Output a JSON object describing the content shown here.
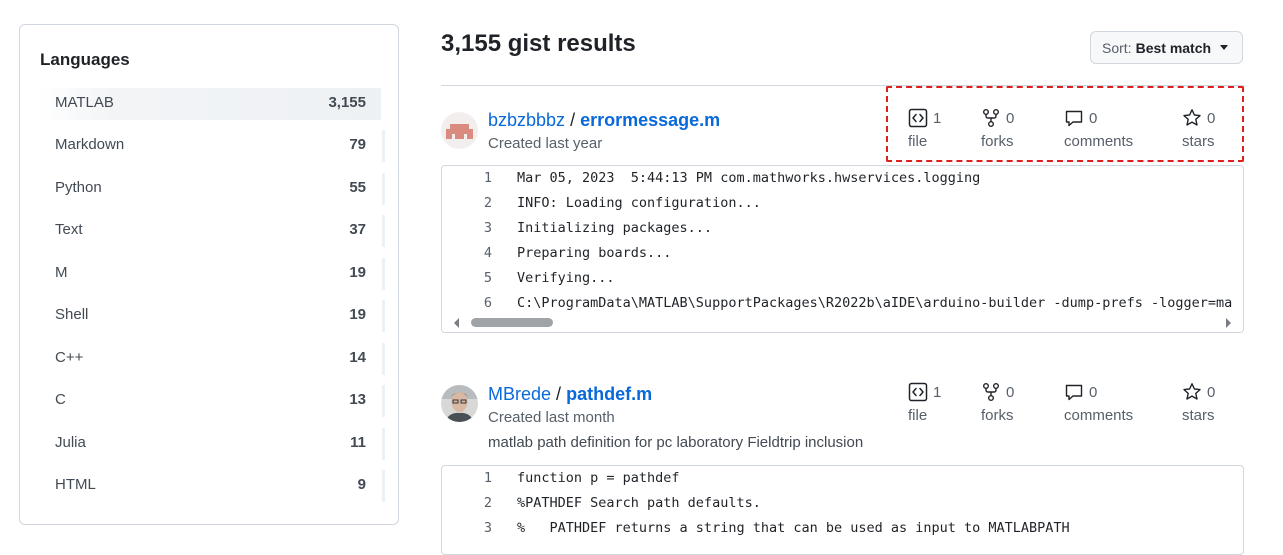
{
  "sidebar": {
    "title": "Languages",
    "items": [
      {
        "name": "MATLAB",
        "count": "3,155",
        "selected": true
      },
      {
        "name": "Markdown",
        "count": "79"
      },
      {
        "name": "Python",
        "count": "55"
      },
      {
        "name": "Text",
        "count": "37"
      },
      {
        "name": "M",
        "count": "19"
      },
      {
        "name": "Shell",
        "count": "19"
      },
      {
        "name": "C++",
        "count": "14"
      },
      {
        "name": "C",
        "count": "13"
      },
      {
        "name": "Julia",
        "count": "11"
      },
      {
        "name": "HTML",
        "count": "9"
      }
    ]
  },
  "main": {
    "results_title": "3,155 gist results",
    "sort": {
      "label": "Sort:",
      "value": "Best match"
    },
    "gists": [
      {
        "owner": "bzbzbbbz",
        "separator": "/",
        "filename": "errormessage.m",
        "created": "Created last year",
        "description": "",
        "stats": {
          "files": {
            "count": "1",
            "label": "file"
          },
          "forks": {
            "count": "0",
            "label": "forks"
          },
          "comments": {
            "count": "0",
            "label": "comments"
          },
          "stars": {
            "count": "0",
            "label": "stars"
          }
        },
        "code": [
          {
            "n": "1",
            "text": "Mar 05, 2023  5:44:13 PM com.mathworks.hwservices.logging"
          },
          {
            "n": "2",
            "text": "INFO: Loading configuration..."
          },
          {
            "n": "3",
            "text": "Initializing packages..."
          },
          {
            "n": "4",
            "text": "Preparing boards..."
          },
          {
            "n": "5",
            "text": "Verifying..."
          },
          {
            "n": "6",
            "text": "C:\\ProgramData\\MATLAB\\SupportPackages\\R2022b\\aIDE\\arduino-builder -dump-prefs -logger=ma"
          }
        ]
      },
      {
        "owner": "MBrede",
        "separator": "/",
        "filename": "pathdef.m",
        "created": "Created last month",
        "description": "matlab path definition for pc laboratory Fieldtrip inclusion",
        "stats": {
          "files": {
            "count": "1",
            "label": "file"
          },
          "forks": {
            "count": "0",
            "label": "forks"
          },
          "comments": {
            "count": "0",
            "label": "comments"
          },
          "stars": {
            "count": "0",
            "label": "stars"
          }
        },
        "code": [
          {
            "n": "1",
            "text": "function p = pathdef"
          },
          {
            "n": "2",
            "text": "%PATHDEF Search path defaults."
          },
          {
            "n": "3",
            "text": "%   PATHDEF returns a string that can be used as input to MATLABPATH"
          }
        ]
      }
    ]
  },
  "colors": {
    "link": "#0969da",
    "highlight_border": "#e01e1e",
    "border": "#d0d7de"
  }
}
